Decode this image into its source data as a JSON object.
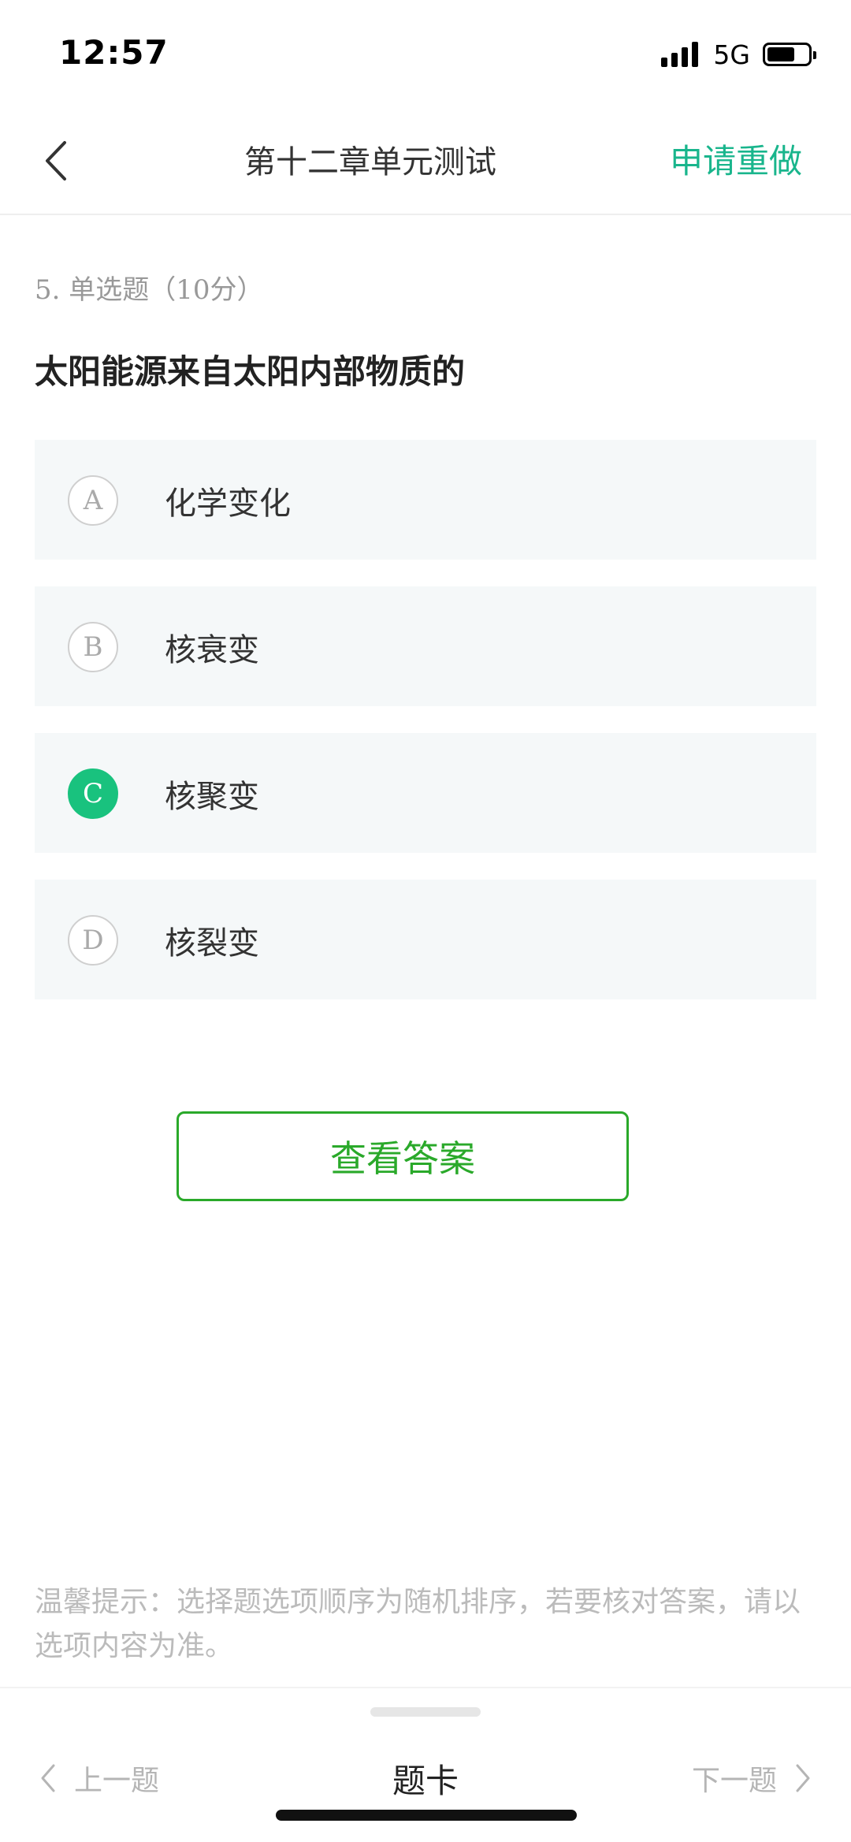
{
  "status_bar": {
    "time": "12:57",
    "network": "5G"
  },
  "nav": {
    "title": "第十二章单元测试",
    "action": "申请重做"
  },
  "question": {
    "meta": "5. 单选题（10分）",
    "stem": "太阳能源来自太阳内部物质的",
    "options": [
      {
        "letter": "A",
        "text": "化学变化",
        "selected": false
      },
      {
        "letter": "B",
        "text": "核衰变",
        "selected": false
      },
      {
        "letter": "C",
        "text": "核聚变",
        "selected": true
      },
      {
        "letter": "D",
        "text": "核裂变",
        "selected": false
      }
    ]
  },
  "view_answer_label": "查看答案",
  "tip": "温馨提示：选择题选项顺序为随机排序，若要核对答案，请以选项内容为准。",
  "bottom_bar": {
    "prev": "上一题",
    "card": "题卡",
    "next": "下一题"
  },
  "colors": {
    "accent": "#19b58c",
    "selected": "#19c27e",
    "button": "#2aa92a"
  }
}
